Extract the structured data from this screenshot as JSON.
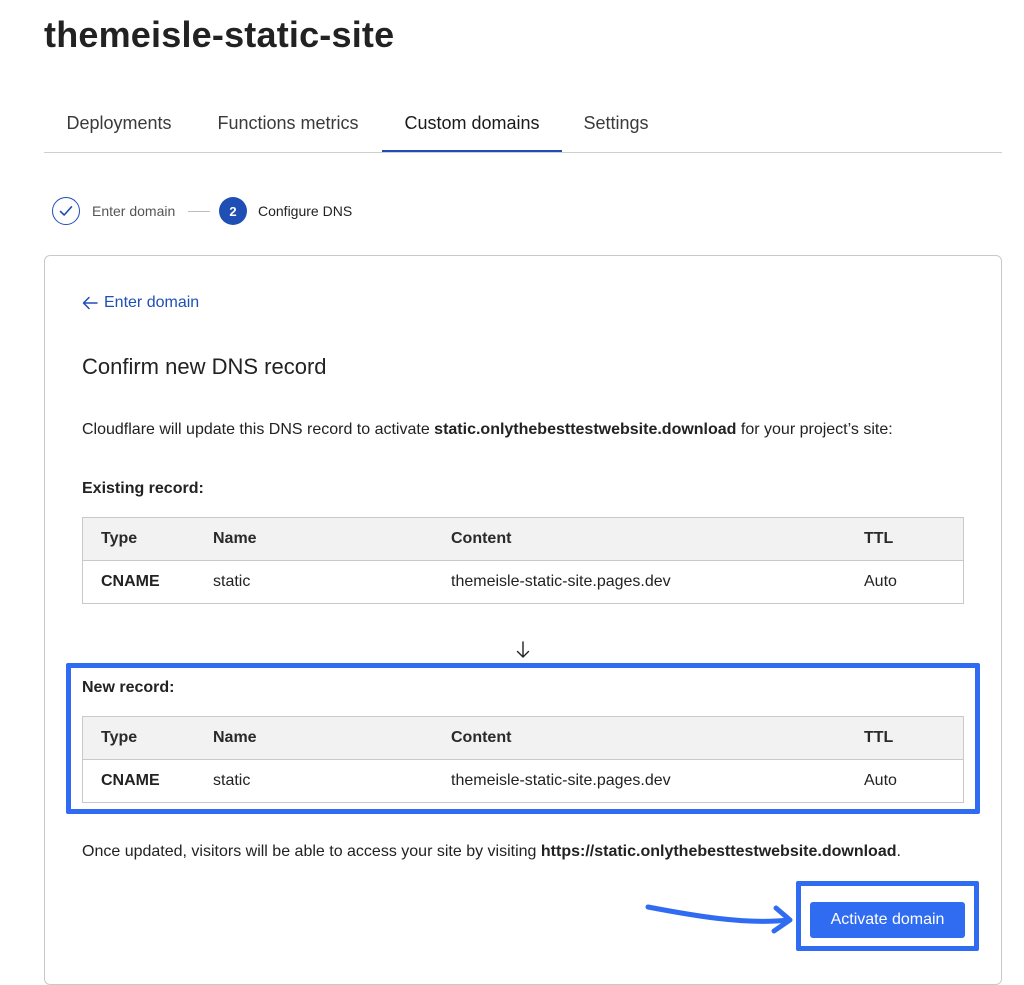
{
  "header": {
    "title": "themeisle-static-site"
  },
  "tabs": [
    {
      "label": "Deployments"
    },
    {
      "label": "Functions metrics"
    },
    {
      "label": "Custom domains"
    },
    {
      "label": "Settings"
    }
  ],
  "stepper": {
    "steps": [
      {
        "number": "",
        "label": "Enter domain",
        "state": "complete"
      },
      {
        "number": "2",
        "label": "Configure DNS",
        "state": "current"
      }
    ]
  },
  "card": {
    "back_link": "Enter domain",
    "heading": "Confirm new DNS record",
    "intro_prefix": "Cloudflare will update this DNS record to activate ",
    "intro_domain": "static.onlythebesttestwebsite.download",
    "intro_suffix": " for your project’s site:",
    "existing": {
      "label": "Existing record:",
      "columns": [
        "Type",
        "Name",
        "Content",
        "TTL"
      ],
      "rows": [
        {
          "type": "CNAME",
          "name": "static",
          "content": "themeisle-static-site.pages.dev",
          "ttl": "Auto"
        }
      ]
    },
    "new": {
      "label": "New record:",
      "columns": [
        "Type",
        "Name",
        "Content",
        "TTL"
      ],
      "rows": [
        {
          "type": "CNAME",
          "name": "static",
          "content": "themeisle-static-site.pages.dev",
          "ttl": "Auto"
        }
      ]
    },
    "outro_prefix": "Once updated, visitors will be able to access your site by visiting ",
    "outro_url": "https://static.onlythebesttestwebsite.download",
    "outro_suffix": ".",
    "activate_button": "Activate domain"
  },
  "colors": {
    "accent": "#1f4fb5",
    "highlight": "#2f6cf2",
    "table_header_bg": "#f2f2f2",
    "border": "#c9c9c9"
  }
}
